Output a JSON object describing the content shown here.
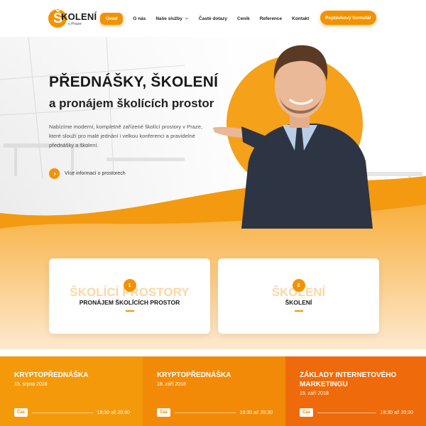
{
  "colors": {
    "brand_orange": "#f39200",
    "event_1": "#f49a0a",
    "event_2": "#f38a07",
    "event_3": "#ef6a0a",
    "text_dark": "#1a1a1a",
    "watermark": "#fbd7a3"
  },
  "logo": {
    "name": "KOLENÍ",
    "initial": "Š",
    "sub": "v Praze"
  },
  "nav": {
    "items": [
      {
        "label": "Úvod",
        "active": true
      },
      {
        "label": "O nás"
      },
      {
        "label": "Naše služby",
        "icon": "chevron-down-icon"
      },
      {
        "label": "Časté dotazy"
      },
      {
        "label": "Ceník"
      },
      {
        "label": "Reference"
      },
      {
        "label": "Kontakt"
      }
    ],
    "cta": "Poptávkový formulář"
  },
  "hero": {
    "title": "PŘEDNÁŠKY, ŠKOLENÍ",
    "subtitle": "a pronájem školících prostor",
    "description": "Nabízíme moderní, kompletně zařízené školící prostory v Praze, které slouží pro malé jednání i velkou konferenci a pravidelné přednášky a školení.",
    "link_icon": "chevron-right-icon",
    "link_text": "Více informací o prostorech"
  },
  "cards": [
    {
      "number": "1",
      "watermark": "ŠKOLÍCÍ PROSTORY",
      "title": "PRONÁJEM ŠKOLÍCÍCH PROSTOR"
    },
    {
      "number": "2",
      "watermark": "ŠKOLENÍ",
      "title": "ŠKOLENÍ"
    }
  ],
  "events": [
    {
      "title": "KRYPTOPŘEDNÁŠKA",
      "date": "15. srpna 2018",
      "label": "Čas",
      "time": "18:30 až 20:30"
    },
    {
      "title": "KRYPTOPŘEDNÁŠKA",
      "date": "18. září 2018",
      "label": "Čas",
      "time": "18:30 až 20:30"
    },
    {
      "title": "ZÁKLADY INTERNETOVÉHO MARKETINGU",
      "date": "19. září 2018",
      "label": "Čas",
      "time": "18:30 až 20:30"
    }
  ]
}
